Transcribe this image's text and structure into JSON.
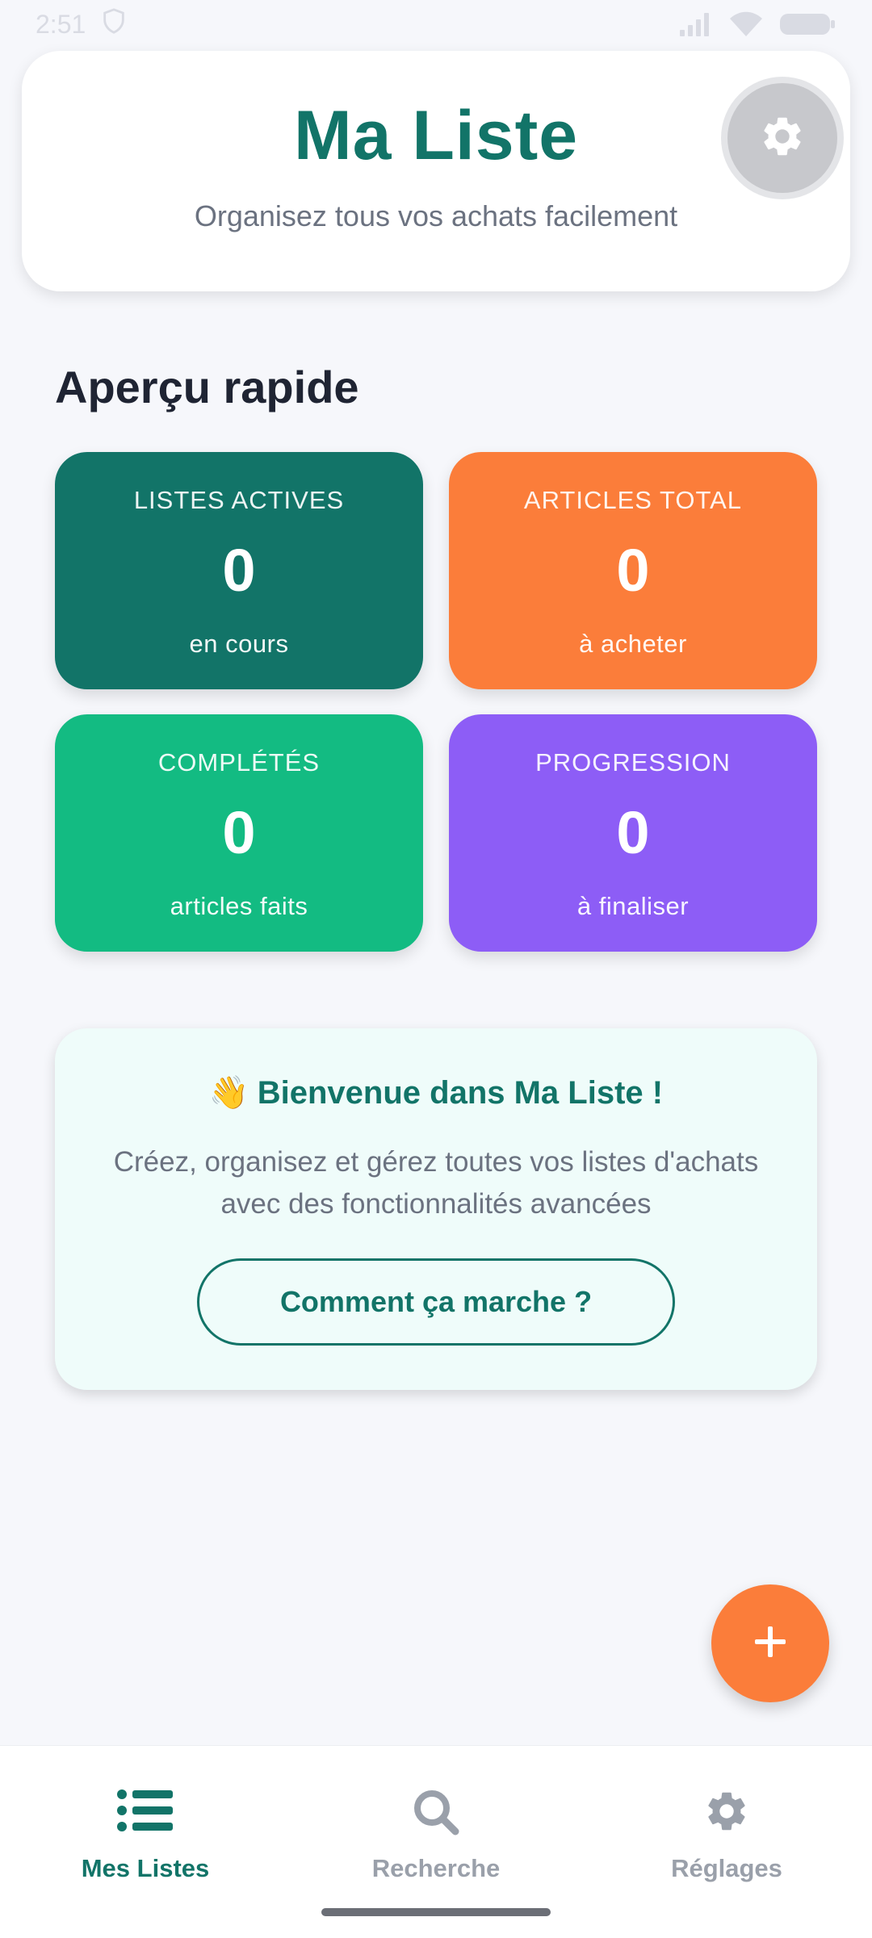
{
  "status_bar": {
    "time": "2:51"
  },
  "header": {
    "title": "Ma Liste",
    "subtitle": "Organisez tous vos achats facilement",
    "settings_icon": "gear-icon"
  },
  "overview": {
    "title": "Aperçu rapide",
    "cards": [
      {
        "label": "LISTES ACTIVES",
        "value": "0",
        "sub": "en cours",
        "color": "#127468"
      },
      {
        "label": "ARTICLES TOTAL",
        "value": "0",
        "sub": "à acheter",
        "color": "#fb7d3a"
      },
      {
        "label": "COMPLÉTÉS",
        "value": "0",
        "sub": "articles faits",
        "color": "#13bb82"
      },
      {
        "label": "PROGRESSION",
        "value": "0",
        "sub": "à finaliser",
        "color": "#8d5df6"
      }
    ]
  },
  "welcome": {
    "emoji": "👋",
    "title": "Bienvenue dans Ma Liste !",
    "text": "Créez, organisez et gérez toutes vos listes d'achats avec des fonctionnalités avancées",
    "button_label": "Comment ça marche ?"
  },
  "fab": {
    "icon": "plus-icon",
    "color": "#fb7d3a"
  },
  "bottom_nav": {
    "items": [
      {
        "label": "Mes Listes",
        "icon": "list-icon",
        "active": true
      },
      {
        "label": "Recherche",
        "icon": "search-icon",
        "active": false
      },
      {
        "label": "Réglages",
        "icon": "gear-icon",
        "active": false
      }
    ]
  },
  "colors": {
    "primary": "#127468",
    "accent": "#fb7d3a",
    "inactive": "#9aa0aa"
  }
}
